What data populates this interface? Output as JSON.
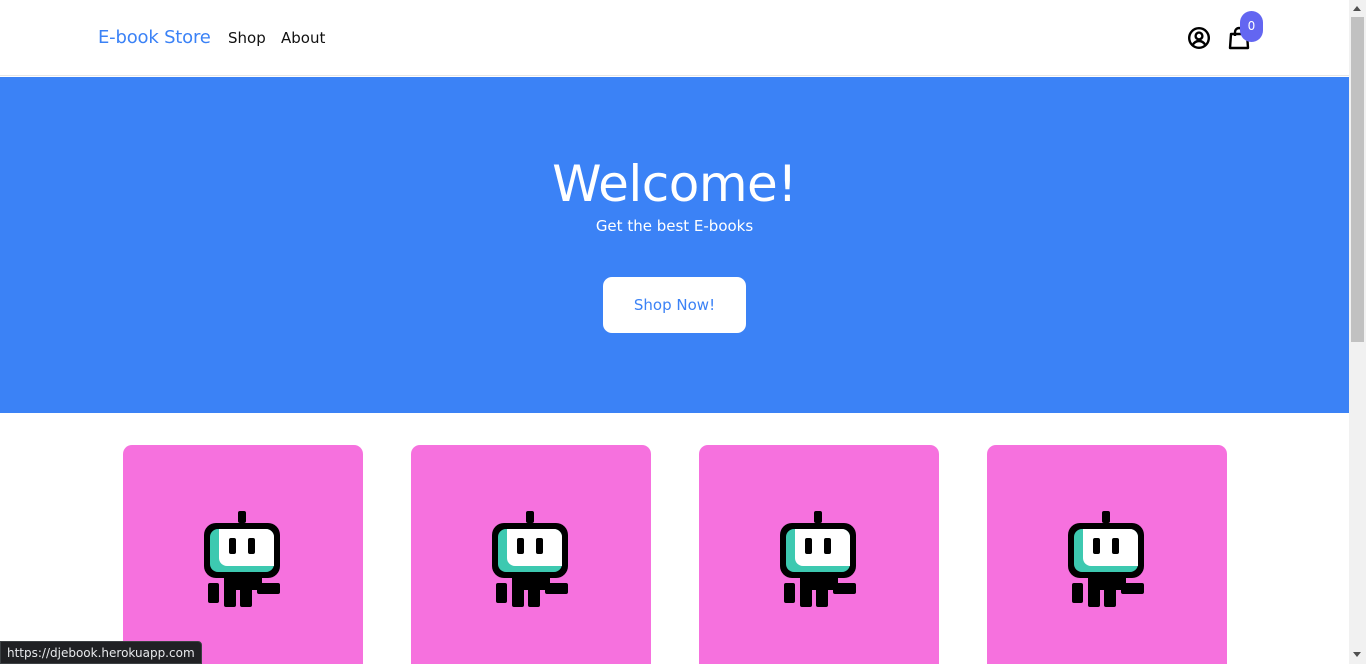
{
  "navbar": {
    "brand": "E-book Store",
    "links": [
      {
        "label": "Shop"
      },
      {
        "label": "About"
      }
    ],
    "user_icon": "user-circle-icon",
    "cart_icon": "shopping-bag-icon",
    "cart_count": "0"
  },
  "hero": {
    "title": "Welcome!",
    "subtitle": "Get the best E-books",
    "button": "Shop Now!"
  },
  "products": [
    {
      "image_icon": "robot-icon"
    },
    {
      "image_icon": "robot-icon"
    },
    {
      "image_icon": "robot-icon"
    },
    {
      "image_icon": "robot-icon"
    }
  ],
  "status_bar": {
    "url": "https://djebook.herokuapp.com"
  },
  "colors": {
    "accent": "#3b82f6",
    "badge": "#6366f1",
    "card_background": "#f671de",
    "robot_screen": "#3dc9b0"
  }
}
